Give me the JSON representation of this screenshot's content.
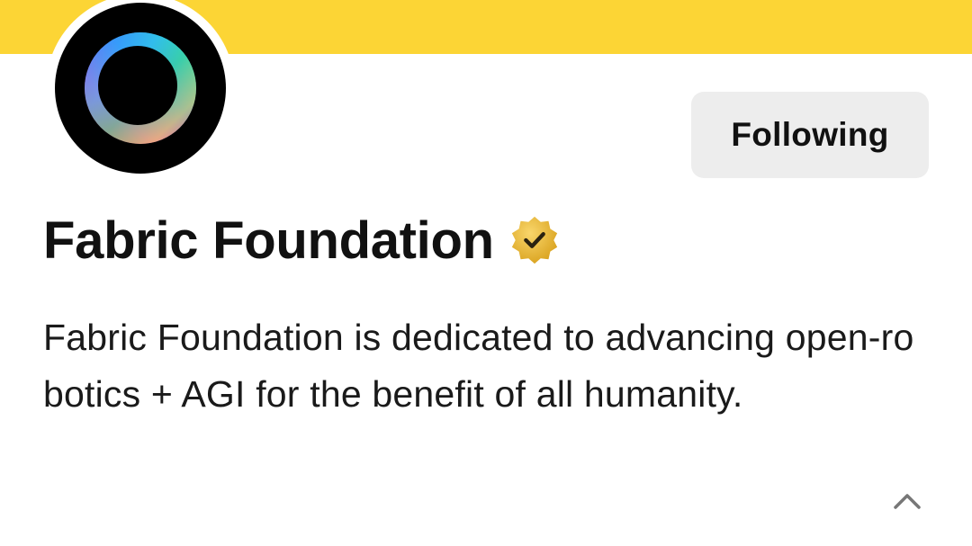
{
  "profile": {
    "display_name": "Fabric Foundation",
    "bio": "Fabric Foundation is dedicated to advancing open-robotics + AGI for the benefit of all humanity.",
    "follow_button_label": "Following",
    "verified": true
  },
  "colors": {
    "banner": "#FCD535",
    "button_bg": "#EDEDED",
    "badge": "#F0B90B"
  },
  "icons": {
    "avatar": "fabric-ring-logo",
    "badge": "verified-badge-icon",
    "collapse": "chevron-up-icon"
  }
}
